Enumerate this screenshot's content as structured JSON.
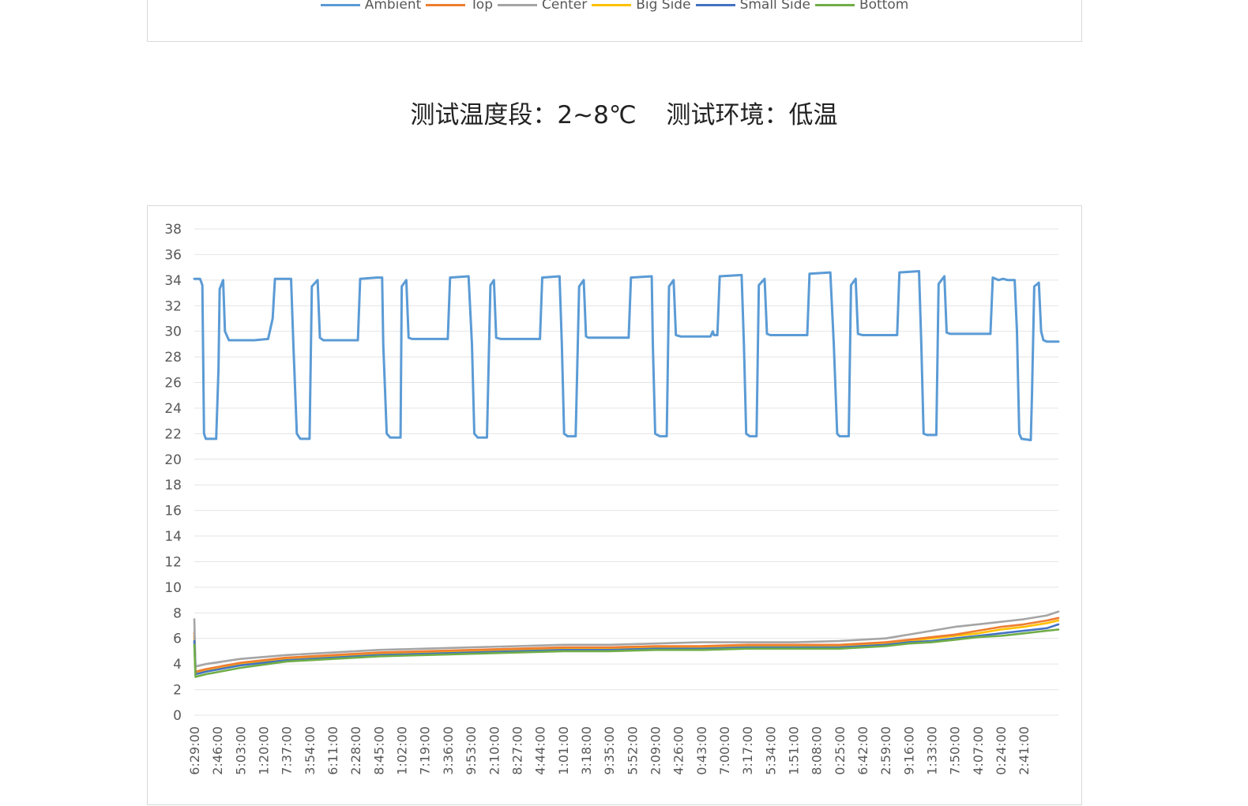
{
  "heading": {
    "range_text": "测试温度段：2~8℃",
    "env_text": "测试环境：低温"
  },
  "colors": {
    "Ambient": "#5b9bd5",
    "Top": "#ed7d31",
    "Center": "#a5a5a5",
    "Big Side": "#ffc000",
    "Small Side": "#4472c4",
    "Bottom": "#70ad47",
    "grid": "#e4e4e4"
  },
  "chart_data": {
    "type": "line",
    "title": "",
    "xlabel": "",
    "ylabel": "",
    "ylim": [
      0,
      38
    ],
    "yticks": [
      0,
      2,
      4,
      6,
      8,
      10,
      12,
      14,
      16,
      18,
      20,
      22,
      24,
      26,
      28,
      30,
      32,
      34,
      36,
      38
    ],
    "grid": true,
    "legend_position": "top",
    "legend": [
      "Ambient",
      "Top",
      "Center",
      "Big Side",
      "Small Side",
      "Bottom"
    ],
    "x_tick_labels": [
      "6:29:00",
      "2:46:00",
      "5:03:00",
      "1:20:00",
      "7:37:00",
      "3:54:00",
      "6:11:00",
      "2:28:00",
      "8:45:00",
      "1:02:00",
      "7:19:00",
      "3:36:00",
      "9:53:00",
      "2:10:00",
      "8:27:00",
      "4:44:00",
      "1:01:00",
      "3:18:00",
      "9:35:00",
      "5:52:00",
      "2:09:00",
      "4:26:00",
      "0:43:00",
      "7:00:00",
      "3:17:00",
      "5:34:00",
      "1:51:00",
      "8:08:00",
      "0:25:00",
      "6:42:00",
      "2:59:00",
      "9:16:00",
      "1:33:00",
      "7:50:00",
      "4:07:00",
      "0:24:00",
      "2:41:00"
    ],
    "x_count": 37,
    "series": [
      {
        "name": "Ambient",
        "points": [
          [
            0.0,
            34.1
          ],
          [
            0.25,
            34.1
          ],
          [
            0.35,
            33.6
          ],
          [
            0.42,
            22
          ],
          [
            0.5,
            21.6
          ],
          [
            0.95,
            21.6
          ],
          [
            1.05,
            27
          ],
          [
            1.1,
            33.3
          ],
          [
            1.25,
            34
          ],
          [
            1.33,
            30
          ],
          [
            1.5,
            29.3
          ],
          [
            2.3,
            29.3
          ],
          [
            2.6,
            29.3
          ],
          [
            3.2,
            29.4
          ],
          [
            3.4,
            31
          ],
          [
            3.5,
            34.1
          ],
          [
            4.2,
            34.1
          ],
          [
            4.3,
            29
          ],
          [
            4.45,
            22
          ],
          [
            4.6,
            21.6
          ],
          [
            5.0,
            21.6
          ],
          [
            5.1,
            33.5
          ],
          [
            5.35,
            34
          ],
          [
            5.45,
            29.5
          ],
          [
            5.6,
            29.3
          ],
          [
            7.1,
            29.3
          ],
          [
            7.2,
            34.1
          ],
          [
            7.9,
            34.2
          ],
          [
            8.15,
            34.2
          ],
          [
            8.2,
            29
          ],
          [
            8.35,
            22
          ],
          [
            8.5,
            21.7
          ],
          [
            8.95,
            21.7
          ],
          [
            9.0,
            33.5
          ],
          [
            9.2,
            34
          ],
          [
            9.3,
            29.5
          ],
          [
            9.45,
            29.4
          ],
          [
            11.0,
            29.4
          ],
          [
            11.1,
            34.2
          ],
          [
            11.9,
            34.3
          ],
          [
            12.05,
            29
          ],
          [
            12.15,
            22
          ],
          [
            12.3,
            21.7
          ],
          [
            12.7,
            21.7
          ],
          [
            12.85,
            33.6
          ],
          [
            13.0,
            34
          ],
          [
            13.1,
            29.5
          ],
          [
            13.3,
            29.4
          ],
          [
            15.0,
            29.4
          ],
          [
            15.1,
            34.2
          ],
          [
            15.85,
            34.3
          ],
          [
            15.95,
            29
          ],
          [
            16.05,
            22
          ],
          [
            16.2,
            21.8
          ],
          [
            16.55,
            21.8
          ],
          [
            16.7,
            33.5
          ],
          [
            16.9,
            34
          ],
          [
            17.0,
            29.6
          ],
          [
            17.1,
            29.5
          ],
          [
            18.85,
            29.5
          ],
          [
            18.95,
            34.2
          ],
          [
            19.85,
            34.3
          ],
          [
            19.9,
            29
          ],
          [
            20.0,
            22
          ],
          [
            20.2,
            21.8
          ],
          [
            20.5,
            21.8
          ],
          [
            20.6,
            33.5
          ],
          [
            20.8,
            34
          ],
          [
            20.9,
            29.7
          ],
          [
            21.1,
            29.6
          ],
          [
            22.4,
            29.6
          ],
          [
            22.5,
            30
          ],
          [
            22.55,
            29.7
          ],
          [
            22.7,
            29.7
          ],
          [
            22.8,
            34.3
          ],
          [
            23.75,
            34.4
          ],
          [
            23.85,
            29
          ],
          [
            23.95,
            22
          ],
          [
            24.1,
            21.8
          ],
          [
            24.4,
            21.8
          ],
          [
            24.5,
            33.6
          ],
          [
            24.75,
            34.1
          ],
          [
            24.85,
            29.8
          ],
          [
            25.0,
            29.7
          ],
          [
            26.6,
            29.7
          ],
          [
            26.7,
            34.5
          ],
          [
            27.6,
            34.6
          ],
          [
            27.75,
            29
          ],
          [
            27.9,
            22
          ],
          [
            28.0,
            21.8
          ],
          [
            28.4,
            21.8
          ],
          [
            28.5,
            33.6
          ],
          [
            28.7,
            34.1
          ],
          [
            28.8,
            29.8
          ],
          [
            29.0,
            29.7
          ],
          [
            30.5,
            29.7
          ],
          [
            30.6,
            34.6
          ],
          [
            31.45,
            34.7
          ],
          [
            31.55,
            29
          ],
          [
            31.65,
            22
          ],
          [
            31.8,
            21.9
          ],
          [
            32.2,
            21.9
          ],
          [
            32.3,
            33.7
          ],
          [
            32.55,
            34.3
          ],
          [
            32.65,
            29.9
          ],
          [
            32.8,
            29.8
          ],
          [
            34.55,
            29.8
          ],
          [
            34.65,
            34.2
          ],
          [
            34.9,
            34
          ],
          [
            35.1,
            34.1
          ],
          [
            35.3,
            34
          ],
          [
            35.6,
            34
          ],
          [
            35.7,
            30
          ],
          [
            35.8,
            22
          ],
          [
            35.9,
            21.6
          ],
          [
            36.3,
            21.5
          ],
          [
            36.35,
            25
          ],
          [
            36.45,
            33.5
          ],
          [
            36.65,
            33.8
          ],
          [
            36.75,
            30
          ],
          [
            36.85,
            29.3
          ],
          [
            37.0,
            29.2
          ],
          [
            37.5,
            29.2
          ]
        ]
      },
      {
        "name": "Top",
        "points": [
          [
            0.0,
            6.5
          ],
          [
            0.05,
            3.4
          ],
          [
            0.5,
            3.6
          ],
          [
            2,
            4.1
          ],
          [
            4,
            4.5
          ],
          [
            6,
            4.7
          ],
          [
            8,
            4.9
          ],
          [
            10,
            5.0
          ],
          [
            12,
            5.1
          ],
          [
            14,
            5.2
          ],
          [
            16,
            5.3
          ],
          [
            18,
            5.3
          ],
          [
            20,
            5.4
          ],
          [
            22,
            5.4
          ],
          [
            24,
            5.5
          ],
          [
            26,
            5.5
          ],
          [
            28,
            5.5
          ],
          [
            30,
            5.7
          ],
          [
            31,
            5.9
          ],
          [
            32,
            6.1
          ],
          [
            33,
            6.3
          ],
          [
            34,
            6.6
          ],
          [
            35,
            6.9
          ],
          [
            36,
            7.1
          ],
          [
            37,
            7.4
          ],
          [
            37.5,
            7.6
          ]
        ]
      },
      {
        "name": "Center",
        "points": [
          [
            0.0,
            7.5
          ],
          [
            0.05,
            3.8
          ],
          [
            0.5,
            4.0
          ],
          [
            2,
            4.4
          ],
          [
            4,
            4.7
          ],
          [
            6,
            4.9
          ],
          [
            8,
            5.1
          ],
          [
            10,
            5.2
          ],
          [
            12,
            5.3
          ],
          [
            14,
            5.4
          ],
          [
            16,
            5.5
          ],
          [
            18,
            5.5
          ],
          [
            20,
            5.6
          ],
          [
            22,
            5.7
          ],
          [
            24,
            5.7
          ],
          [
            26,
            5.7
          ],
          [
            28,
            5.8
          ],
          [
            30,
            6.0
          ],
          [
            31,
            6.3
          ],
          [
            32,
            6.6
          ],
          [
            33,
            6.9
          ],
          [
            34,
            7.1
          ],
          [
            35,
            7.3
          ],
          [
            36,
            7.5
          ],
          [
            37,
            7.8
          ],
          [
            37.5,
            8.1
          ]
        ]
      },
      {
        "name": "Big Side",
        "points": [
          [
            0.0,
            6.2
          ],
          [
            0.05,
            3.3
          ],
          [
            0.5,
            3.5
          ],
          [
            2,
            4.0
          ],
          [
            4,
            4.4
          ],
          [
            6,
            4.6
          ],
          [
            8,
            4.8
          ],
          [
            10,
            4.9
          ],
          [
            12,
            5.0
          ],
          [
            14,
            5.1
          ],
          [
            16,
            5.2
          ],
          [
            18,
            5.2
          ],
          [
            20,
            5.3
          ],
          [
            22,
            5.3
          ],
          [
            24,
            5.4
          ],
          [
            26,
            5.4
          ],
          [
            28,
            5.4
          ],
          [
            30,
            5.6
          ],
          [
            31,
            5.8
          ],
          [
            32,
            6.0
          ],
          [
            33,
            6.2
          ],
          [
            34,
            6.4
          ],
          [
            35,
            6.7
          ],
          [
            36,
            6.9
          ],
          [
            37,
            7.2
          ],
          [
            37.5,
            7.4
          ]
        ]
      },
      {
        "name": "Small Side",
        "points": [
          [
            0.0,
            5.8
          ],
          [
            0.05,
            3.2
          ],
          [
            0.5,
            3.4
          ],
          [
            2,
            3.9
          ],
          [
            4,
            4.3
          ],
          [
            6,
            4.5
          ],
          [
            8,
            4.7
          ],
          [
            10,
            4.8
          ],
          [
            12,
            4.9
          ],
          [
            14,
            5.0
          ],
          [
            16,
            5.1
          ],
          [
            18,
            5.1
          ],
          [
            20,
            5.2
          ],
          [
            22,
            5.2
          ],
          [
            24,
            5.3
          ],
          [
            26,
            5.3
          ],
          [
            28,
            5.3
          ],
          [
            30,
            5.5
          ],
          [
            31,
            5.7
          ],
          [
            32,
            5.8
          ],
          [
            33,
            6.0
          ],
          [
            34,
            6.2
          ],
          [
            35,
            6.4
          ],
          [
            36,
            6.6
          ],
          [
            37,
            6.8
          ],
          [
            37.5,
            7.1
          ]
        ]
      },
      {
        "name": "Bottom",
        "points": [
          [
            0.0,
            5.5
          ],
          [
            0.05,
            3.0
          ],
          [
            0.5,
            3.2
          ],
          [
            2,
            3.7
          ],
          [
            4,
            4.2
          ],
          [
            6,
            4.4
          ],
          [
            8,
            4.6
          ],
          [
            10,
            4.7
          ],
          [
            12,
            4.8
          ],
          [
            14,
            4.9
          ],
          [
            16,
            5.0
          ],
          [
            18,
            5.0
          ],
          [
            20,
            5.1
          ],
          [
            22,
            5.1
          ],
          [
            24,
            5.2
          ],
          [
            26,
            5.2
          ],
          [
            28,
            5.2
          ],
          [
            30,
            5.4
          ],
          [
            31,
            5.6
          ],
          [
            32,
            5.7
          ],
          [
            33,
            5.9
          ],
          [
            34,
            6.1
          ],
          [
            35,
            6.2
          ],
          [
            36,
            6.4
          ],
          [
            37,
            6.6
          ],
          [
            37.5,
            6.7
          ]
        ]
      }
    ]
  }
}
